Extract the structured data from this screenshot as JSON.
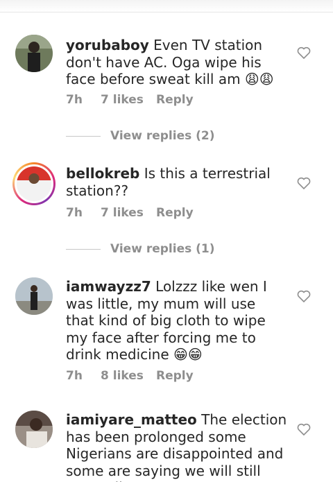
{
  "header": {
    "cut_text": "View replies (2)"
  },
  "comments": [
    {
      "username": "yorubaboy",
      "text": "Even TV station don't have AC. Oga wipe his face before sweat kill am",
      "emoji": "😩😩",
      "time": "7h",
      "likes": "7 likes",
      "reply": "Reply",
      "view_replies": "View replies (2)"
    },
    {
      "username": "bellokreb",
      "text": "Is this a terrestrial station??",
      "emoji": "",
      "time": "7h",
      "likes": "7 likes",
      "reply": "Reply",
      "view_replies": "View replies (1)"
    },
    {
      "username": "iamwayzz7",
      "text": "Lolzzz like wen I was little,  my mum will use that kind of big cloth to wipe my face after forcing me to drink medicine",
      "emoji": "😁😁",
      "time": "7h",
      "likes": "8 likes",
      "reply": "Reply",
      "view_replies": ""
    },
    {
      "username": "iamiyare_matteo",
      "text": "The election has been prolonged some Nigerians are disappointed and some are saying we will still vote atiku",
      "emoji": "",
      "time": "",
      "likes": "",
      "reply": "",
      "view_replies": ""
    }
  ],
  "icons": {
    "like": "heart-outline-icon"
  },
  "colors": {
    "text": "#262626",
    "muted": "#8e8e8e",
    "divider": "#c7c7c7"
  }
}
